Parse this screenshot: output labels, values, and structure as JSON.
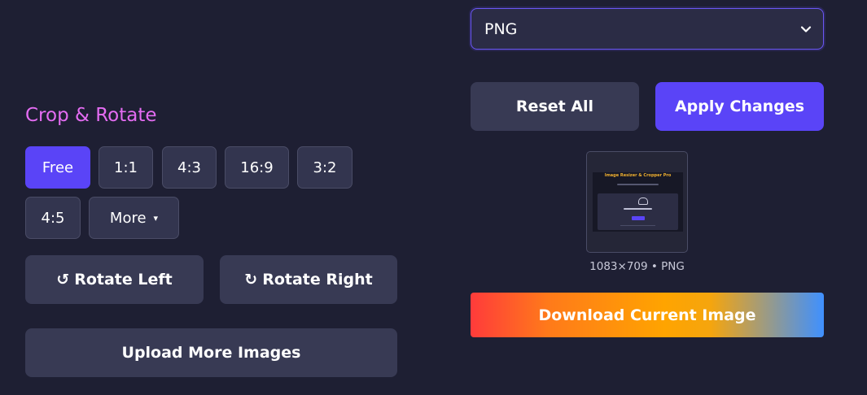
{
  "format_select": {
    "value": "PNG"
  },
  "actions": {
    "reset": "Reset All",
    "apply": "Apply Changes"
  },
  "thumbnail": {
    "caption": "1083×709 • PNG",
    "preview_title": "Image Resizer & Cropper Pro"
  },
  "download": {
    "label": "Download Current Image"
  },
  "crop_rotate": {
    "title": "Crop & Rotate",
    "ratios": [
      "Free",
      "1:1",
      "4:3",
      "16:9",
      "3:2",
      "4:5"
    ],
    "active_ratio": "Free",
    "more": {
      "label": "More",
      "caret": "▾"
    },
    "rotate_left": {
      "icon": "↺",
      "label": "Rotate Left"
    },
    "rotate_right": {
      "icon": "↻",
      "label": "Rotate Right"
    },
    "upload_more": "Upload More Images"
  },
  "colors": {
    "background": "#1e1f33",
    "accent": "#5a44f7",
    "title": "#e46cf2"
  }
}
